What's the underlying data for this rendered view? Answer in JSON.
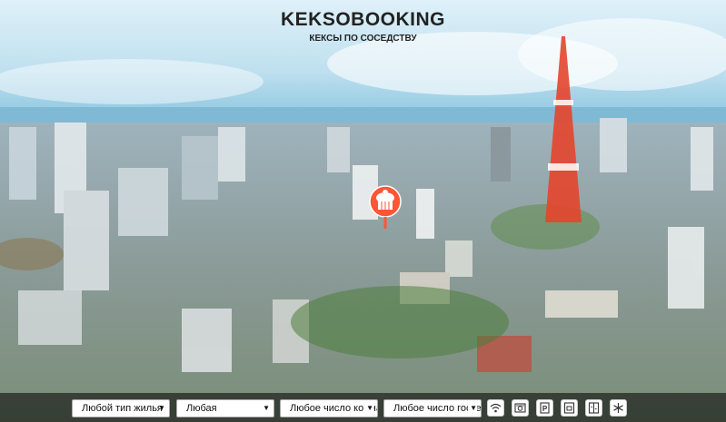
{
  "header": {
    "title": "KEKSOBOOKING",
    "subtitle": "КЕКСЫ ПО СОСЕДСТВУ"
  },
  "map": {
    "main_pin": "cupcake-pin-icon",
    "accent_color": "#ff5635"
  },
  "filters": {
    "housing_type": {
      "selected": "Любой тип жилья"
    },
    "price": {
      "selected": "Любая"
    },
    "rooms": {
      "selected": "Любое число комнат"
    },
    "guests": {
      "selected": "Любое число гостей"
    },
    "features": [
      {
        "name": "wifi",
        "icon": "wifi-icon"
      },
      {
        "name": "dishwasher",
        "icon": "dishwasher-icon"
      },
      {
        "name": "parking",
        "icon": "parking-icon"
      },
      {
        "name": "washer",
        "icon": "washer-icon"
      },
      {
        "name": "elevator",
        "icon": "elevator-icon"
      },
      {
        "name": "conditioner",
        "icon": "snowflake-icon"
      }
    ]
  }
}
